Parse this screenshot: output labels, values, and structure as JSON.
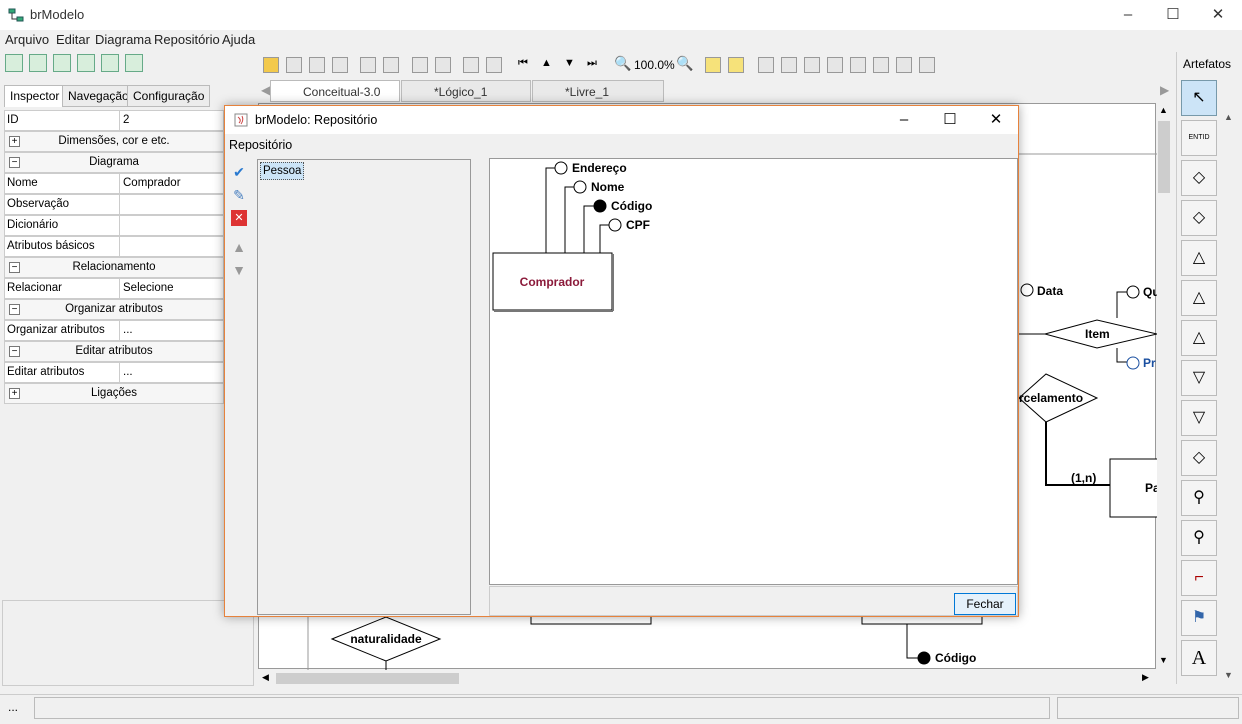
{
  "app": {
    "title": "brModelo"
  },
  "menubar": {
    "items": [
      "Arquivo",
      "Editar",
      "Diagrama",
      "Repositório",
      "Ajuda"
    ]
  },
  "left_tabs": [
    "Inspector",
    "Navegação",
    "Configuração"
  ],
  "inspector": {
    "id_label": "ID",
    "id_value": "2",
    "sec_dimensoes": "Dimensões, cor e etc.",
    "sec_diagrama": "Diagrama",
    "nome_label": "Nome",
    "nome_value": "Comprador",
    "observacao_label": "Observação",
    "dicionario_label": "Dicionário",
    "atributos_label": "Atributos básicos",
    "sec_relacionamento": "Relacionamento",
    "relacionar_label": "Relacionar",
    "relacionar_value": "Selecione",
    "sec_organizar": "Organizar atributos",
    "organizar_label": "Organizar atributos",
    "organizar_value": "...",
    "sec_editar": "Editar atributos",
    "editar_label": "Editar atributos",
    "editar_value": "...",
    "sec_ligacoes": "Ligações"
  },
  "toolbar": {
    "zoom": "100.0%"
  },
  "doc_tabs": [
    "Conceitual-3.0",
    "*Lógico_1",
    "*Livre_1"
  ],
  "canvas": {
    "data": "Data",
    "qu": "Qu",
    "item": "Item",
    "pr": "Pr",
    "parcelamento": "rcelamento",
    "cardinality": "(1,n)",
    "pa": "Pa",
    "naturalidade": "naturalidade",
    "codigo": "Código"
  },
  "artefatos": {
    "title": "Artefatos",
    "entity_icon_text": "ENTID",
    "text_tool": "A"
  },
  "dialog": {
    "title": "brModelo: Repositório",
    "menu": "Repositório",
    "list_item": "Pessoa",
    "entity": "Comprador",
    "attributes": [
      "Endereço",
      "Nome",
      "Código",
      "CPF"
    ],
    "close_button": "Fechar"
  },
  "status": {
    "text": "..."
  }
}
